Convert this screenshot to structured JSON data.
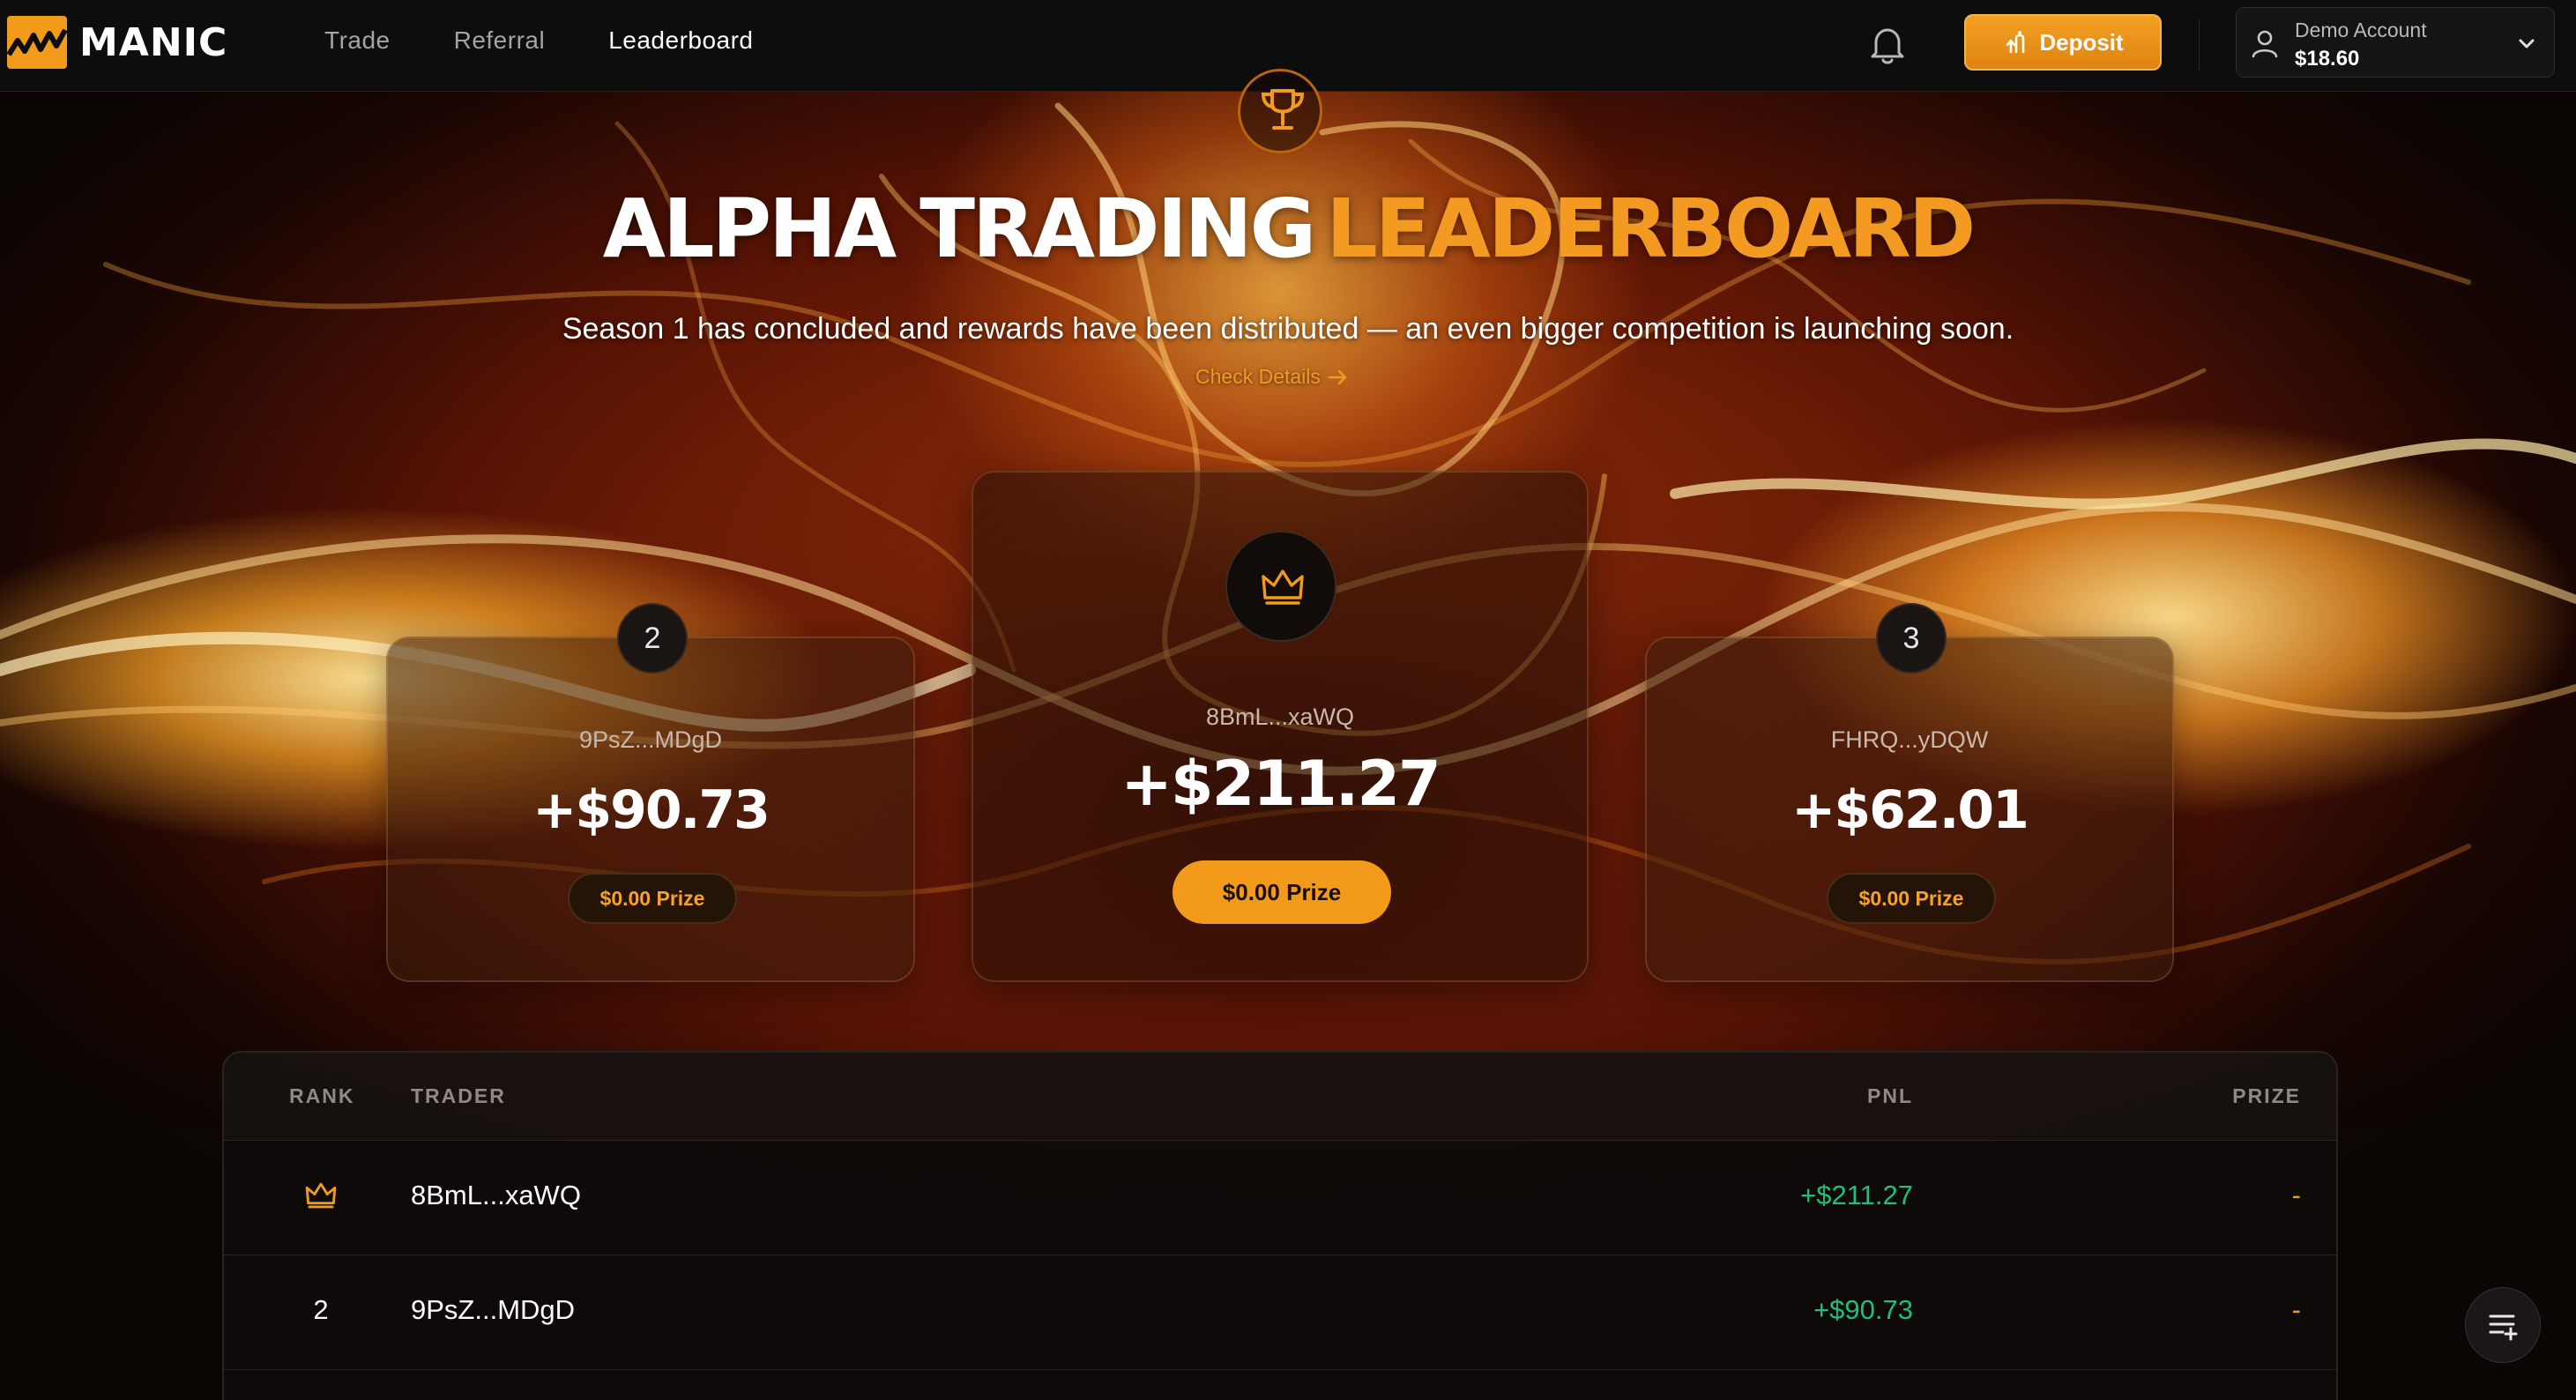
{
  "header": {
    "logo_text": "MANIC",
    "nav": [
      {
        "label": "Trade",
        "active": false
      },
      {
        "label": "Referral",
        "active": false
      },
      {
        "label": "Leaderboard",
        "active": true
      }
    ],
    "deposit_label": "Deposit",
    "account": {
      "label": "Demo Account",
      "balance": "$18.60"
    }
  },
  "hero": {
    "title_white": "ALPHA TRADING",
    "title_orange": "LEADERBOARD",
    "subtitle": "Season 1 has concluded and rewards have been distributed — an even bigger competition is launching soon.",
    "link_label": "Check Details"
  },
  "podium": {
    "first": {
      "trader": "8BmL...xaWQ",
      "pnl": "+$211.27",
      "prize": "$0.00 Prize"
    },
    "second": {
      "rank": "2",
      "trader": "9PsZ...MDgD",
      "pnl": "+$90.73",
      "prize": "$0.00 Prize"
    },
    "third": {
      "rank": "3",
      "trader": "FHRQ...yDQW",
      "pnl": "+$62.01",
      "prize": "$0.00 Prize"
    }
  },
  "table": {
    "headers": {
      "rank": "RANK",
      "trader": "TRADER",
      "pnl": "PNL",
      "prize": "PRIZE"
    },
    "rows": [
      {
        "rank": "",
        "rank_icon": "crown-icon",
        "trader": "8BmL...xaWQ",
        "pnl": "+$211.27",
        "prize": "-"
      },
      {
        "rank": "2",
        "trader": "9PsZ...MDgD",
        "pnl": "+$90.73",
        "prize": "-"
      }
    ]
  },
  "colors": {
    "accent": "#f29a1a",
    "positive": "#1fbf78",
    "header_bg": "#0e0d0d"
  }
}
